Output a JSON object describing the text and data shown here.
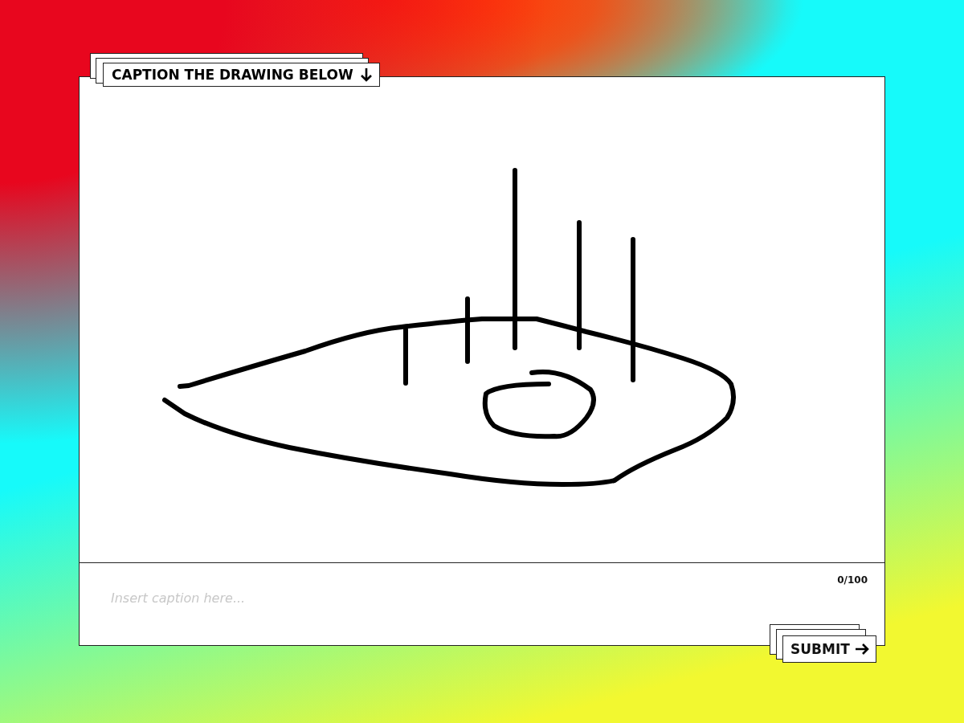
{
  "prompt": {
    "title": "CAPTION THE DRAWING BELOW"
  },
  "caption": {
    "placeholder": "Insert caption here...",
    "counter": "0/100"
  },
  "submit": {
    "label": "SUBMIT"
  }
}
